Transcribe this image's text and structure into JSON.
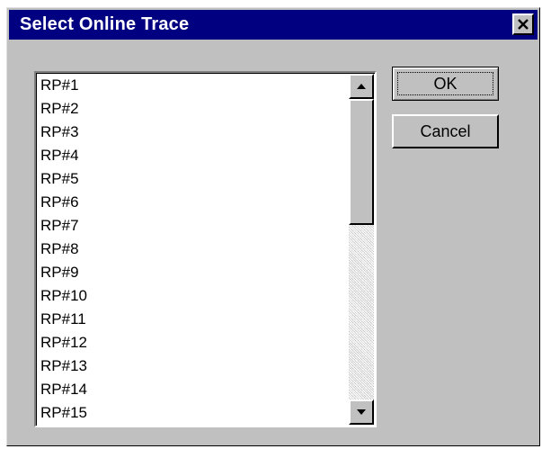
{
  "window": {
    "title": "Select Online Trace",
    "close_icon": "close-icon"
  },
  "list": {
    "items": [
      "RP#1",
      "RP#2",
      "RP#3",
      "RP#4",
      "RP#5",
      "RP#6",
      "RP#7",
      "RP#8",
      "RP#9",
      "RP#10",
      "RP#11",
      "RP#12",
      "RP#13",
      "RP#14",
      "RP#15"
    ],
    "scroll_up_icon": "arrow-up-icon",
    "scroll_down_icon": "arrow-down-icon"
  },
  "buttons": {
    "ok_label": "OK",
    "cancel_label": "Cancel"
  },
  "colors": {
    "titlebar": "#000080",
    "dialog_face": "#c0c0c0"
  }
}
